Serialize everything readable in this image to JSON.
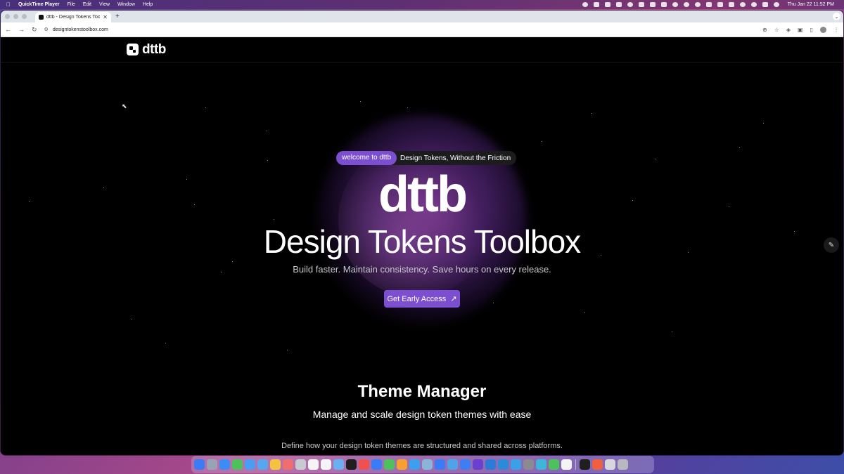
{
  "menubar": {
    "app_name": "QuickTime Player",
    "menus": [
      "File",
      "Edit",
      "View",
      "Window",
      "Help"
    ],
    "clock": "Thu Jan 22  11:52 PM"
  },
  "browser": {
    "tab_title": "dttb - Design Tokens Toolbox",
    "url": "designtokenstoolbox.com"
  },
  "site": {
    "logo_text": "dttb",
    "badge": "welcome to dttb",
    "tagline": "Design Tokens, Without the Friction",
    "hero_logo": "dttb",
    "title": "Design Tokens Toolbox",
    "subtitle": "Build faster. Maintain consistency. Save hours on every release.",
    "cta_label": "Get Early Access",
    "section_title": "Theme Manager",
    "section_subtitle": "Manage and scale design token themes with ease",
    "section_desc": "Define how your design token themes are structured and shared across platforms."
  },
  "colors": {
    "accent": "#7c4fd0",
    "page_bg": "#000000"
  },
  "dock": {
    "icon_colors": [
      "#3b7bf5",
      "#9aa3b5",
      "#3b8cf5",
      "#4ec25a",
      "#4a9df0",
      "#58a6f0",
      "#f5c242",
      "#ef6f6f",
      "#c9c9d0",
      "#f4f4f4",
      "#f4f4f4",
      "#6ab0f0",
      "#1f1f1f",
      "#f05050",
      "#3b7bf5",
      "#4ec25a",
      "#f5a030",
      "#3ba0f0",
      "#8ab4d8",
      "#3b7bf5",
      "#4fa3e8",
      "#3f7ef2",
      "#6b3fd0",
      "#2d7bd8",
      "#2a8bd8",
      "#3aa0e8",
      "#8a8a90",
      "#3fb5d8",
      "#4ec25a",
      "#f4f4f4",
      "#1f1f1f",
      "#f06040",
      "#d8d8dc",
      "#b8b8c0"
    ]
  }
}
